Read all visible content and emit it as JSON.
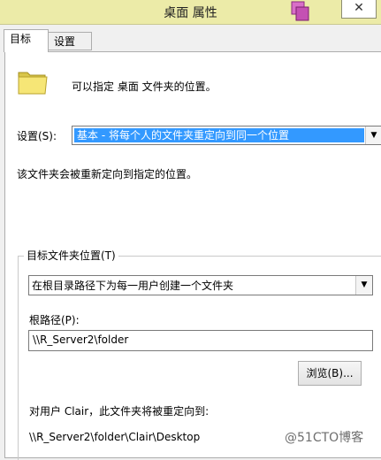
{
  "window": {
    "title": "桌面 属性",
    "close_glyph": "✕"
  },
  "tabs": [
    {
      "label": "目标"
    },
    {
      "label": "设置"
    }
  ],
  "target": {
    "description": "可以指定 桌面 文件夹的位置。",
    "setting_label": "设置(S):",
    "setting_value": "基本 - 将每个人的文件夹重定向到同一个位置",
    "info_text": "该文件夹会被重新定向到指定的位置。",
    "group_label": "目标文件夹位置(T)",
    "location_value": "在根目录路径下为每一用户创建一个文件夹",
    "root_path_label": "根路径(P):",
    "root_path_value": "\\\\R_Server2\\folder",
    "browse_button": "浏览(B)...",
    "user_redirect_text": "对用户 Clair，此文件夹将被重定向到:",
    "redirect_path": "\\\\R_Server2\\folder\\Clair\\Desktop"
  },
  "watermark": "@51CTO博客",
  "icons": {
    "app": "properties-app-icon",
    "folder": "folder-icon",
    "dropdown": "chevron-down-icon"
  },
  "colors": {
    "titlebar": "#eceba8",
    "selection": "#3399ff"
  }
}
